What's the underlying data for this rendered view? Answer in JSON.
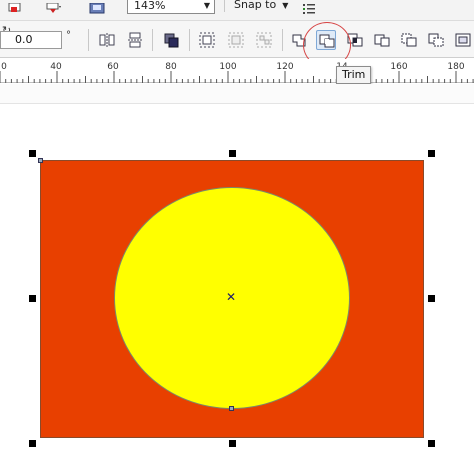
{
  "toolbar_top": {
    "zoom_value": "143%",
    "snap_label": "Snap to"
  },
  "property_bar": {
    "angle_value": "0.0",
    "angle_unit": "°",
    "tooltip": "Trim"
  },
  "ruler": {
    "labels": [
      "0",
      "40",
      "60",
      "80",
      "100",
      "120",
      "14",
      "160",
      "180"
    ]
  },
  "colors": {
    "rectangle_fill": "#e84000",
    "ellipse_fill": "#ffff00",
    "trim_highlight": "#d64545"
  }
}
